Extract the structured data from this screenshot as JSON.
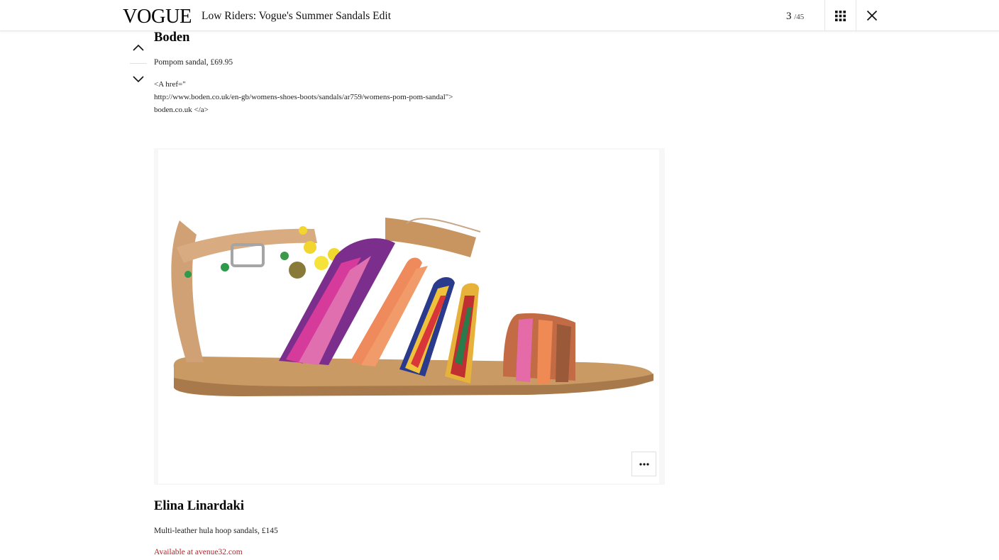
{
  "header": {
    "logo": "VOGUE",
    "title": "Low Riders: Vogue's Summer Sandals Edit",
    "counter_current": "3",
    "counter_total": "/45",
    "grid_icon": "grid-icon",
    "close_icon": "close-icon"
  },
  "nav": {
    "up_icon": "chevron-up-icon",
    "down_icon": "chevron-down-icon"
  },
  "items": [
    {
      "brand": "Boden",
      "description": "Pompom sandal, £69.95",
      "link_lines": [
        "<A href=\"",
        "http://www.boden.co.uk/en-gb/womens-shoes-boots/sandals/ar759/womens-pom-pom-sandal\">",
        "boden.co.uk </a>"
      ]
    },
    {
      "brand": "Elina Linardaki",
      "description": "Multi-leather hula hoop sandals, £145",
      "availability": "Available at avenue32.com"
    }
  ],
  "image": {
    "subject": "sandal-image",
    "more_icon": "more-dots-icon"
  },
  "colors": {
    "link_red": "#b3262b",
    "border": "#e6e6e6"
  }
}
